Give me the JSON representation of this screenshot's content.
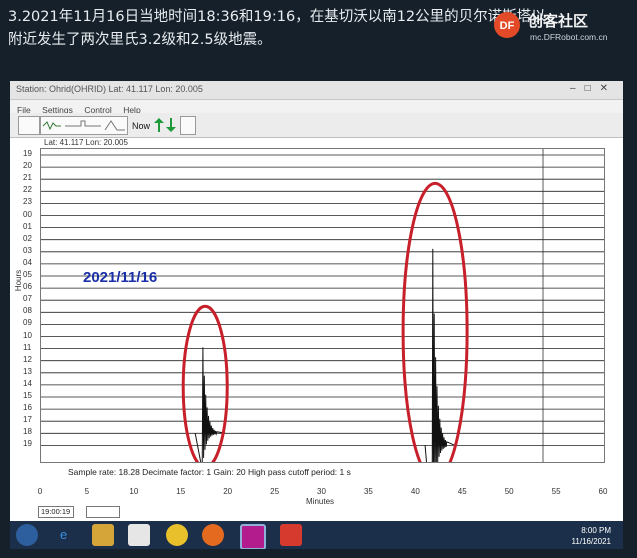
{
  "caption": {
    "line1": "3.2021年11月16日当地时间18:36和19:16，在基切沃以南12公里的贝尔诺斯塔以",
    "line2": "附近发生了两次里氏3.2级和2.5级地震。"
  },
  "watermark": {
    "name": "创客社区",
    "url": "mc.DFRobot.com.cn",
    "logo_text": "DF"
  },
  "window": {
    "title": "Station: Ohrid(OHRID) Lat: 41.117 Lon: 20.005",
    "menu": [
      "File",
      "Settings",
      "Control",
      "Help"
    ],
    "toolbar": {
      "now_label": "Now"
    },
    "coords": "Lat: 41.117  Lon: 20.005"
  },
  "seismogram": {
    "date_label": "2021/11/16",
    "hour_labels": [
      "19",
      "20",
      "21",
      "22",
      "23",
      "00",
      "01",
      "02",
      "03",
      "04",
      "05",
      "06",
      "07",
      "08",
      "09",
      "10",
      "11",
      "12",
      "13",
      "14",
      "15",
      "16",
      "17",
      "18",
      "19"
    ],
    "y_axis_title": "Hours",
    "x_ticks": [
      "0",
      "5",
      "10",
      "15",
      "20",
      "25",
      "30",
      "35",
      "40",
      "45",
      "50",
      "55",
      "60"
    ],
    "x_axis_title": "Minutes",
    "info_line": "Sample rate: 18.28  Decimate factor: 1  Gain: 20  High pass cutoff period: 1 s",
    "events": [
      {
        "label": "18:36",
        "hour_row": "18",
        "minute": 17.5
      },
      {
        "label": "19:16",
        "hour_row": "19",
        "minute": 42
      }
    ]
  },
  "status": {
    "time_box": "19:00:19"
  },
  "taskbar": {
    "clock_time": "8:00 PM",
    "clock_date": "11/16/2021"
  }
}
